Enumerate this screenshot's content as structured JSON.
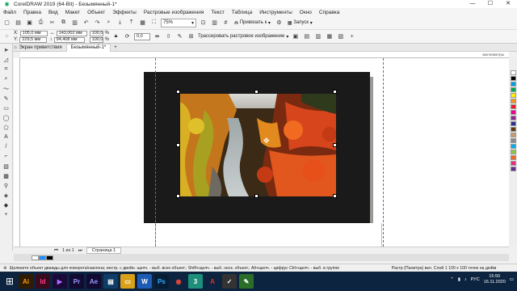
{
  "title": "CorelDRAW 2019 (64-Bit) - Безымянный-1*",
  "menu": [
    "Файл",
    "Правка",
    "Вид",
    "Макет",
    "Объект",
    "Эффекты",
    "Растровые изображения",
    "Текст",
    "Таблица",
    "Инструменты",
    "Окно",
    "Справка"
  ],
  "standard": {
    "zoom": "75%",
    "snap_label": "Привязать к",
    "launch_label": "Запуск"
  },
  "props": {
    "x_label": "X:",
    "x_value": "105,0 мм",
    "y_label": "Y:",
    "y_value": "229,5 мм",
    "w_value": "143,002 мм",
    "h_value": "94,408 мм",
    "sx_value": "100,0",
    "sy_value": "100,0",
    "pct": "%",
    "angle": "0,0",
    "trace_label": "Трассировать растровое изображение"
  },
  "tabs": [
    {
      "label": "Экран приветствия"
    },
    {
      "label": "Безымянный-1*"
    }
  ],
  "ruler_unit": "миллиметры",
  "page_nav": {
    "page_tab": "Страница 1",
    "counter": "1 из 1"
  },
  "status": {
    "hint": "Щелкните объект дважды для поворота/наклона; инстр. с двойн. щелч. - выб. всех объект.; Shift+щелч. - выб. неск. объект.; Alt+щелч. - цифрус Ctrl+щелч. - выб. в группе",
    "info": "Растр (Палитра) вкл. Слой 1 100 x 100 точек на дюйм"
  },
  "taskbar": {
    "apps": [
      {
        "name": "Ai",
        "bg": "#2e1b06",
        "fg": "#ff9a00"
      },
      {
        "name": "Id",
        "bg": "#3a0a1d",
        "fg": "#ff3d8b"
      },
      {
        "name": "▶",
        "bg": "#1a0a3a",
        "fg": "#b46aff"
      },
      {
        "name": "Pr",
        "bg": "#120a30",
        "fg": "#9999ff"
      },
      {
        "name": "Ae",
        "bg": "#120a30",
        "fg": "#9999ff"
      },
      {
        "name": "▤",
        "bg": "#0f3d66",
        "fg": "#fff"
      },
      {
        "name": "▭",
        "bg": "#d9a019",
        "fg": "#fff"
      },
      {
        "name": "W",
        "bg": "#1e5bb5",
        "fg": "#fff"
      },
      {
        "name": "Ps",
        "bg": "#061e33",
        "fg": "#31a8ff"
      },
      {
        "name": "◉",
        "bg": "#0c2440",
        "fg": "#e8483a"
      },
      {
        "name": "3",
        "bg": "#1e8f7a",
        "fg": "#fff"
      },
      {
        "name": "A",
        "bg": "#0c2440",
        "fg": "#e0302a"
      },
      {
        "name": "✓",
        "bg": "#333",
        "fg": "#fff"
      },
      {
        "name": "✎",
        "bg": "#2a6e2a",
        "fg": "#fff"
      }
    ],
    "lang": "РУС",
    "time": "15:50",
    "date": "16.11.2020"
  },
  "colors": {
    "accent": "#1e5bb5",
    "palette": [
      "#ffffff",
      "#000000",
      "#00a0e3",
      "#00a651",
      "#fff200",
      "#f7941d",
      "#ed1c24",
      "#ec008c",
      "#92278f",
      "#2e3192",
      "#603913",
      "#c69c6d",
      "#898989",
      "#00aeef",
      "#8dc63f",
      "#f26522",
      "#ee2a7b",
      "#662d91"
    ]
  }
}
